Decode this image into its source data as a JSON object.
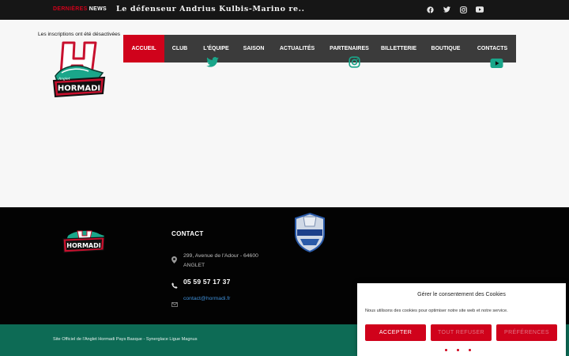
{
  "topbar": {
    "news_prefix": "DERNIÈRES",
    "news_suffix": "NEWS",
    "ticker": "Le défenseur Andrius Kulbis-Marino re..",
    "social_icons": [
      "facebook-icon",
      "twitter-icon",
      "instagram-icon",
      "youtube-icon"
    ]
  },
  "header": {
    "notice": "Les inscriptions ont été désactivées",
    "logo_text": "HORMADI",
    "logo_letter": "H",
    "logo_small": "Anglet"
  },
  "nav": {
    "items": [
      {
        "label": "ACCUEIL",
        "active": true
      },
      {
        "label": "CLUB",
        "active": false
      },
      {
        "label": "L'ÉQUIPE",
        "active": false
      },
      {
        "label": "SAISON",
        "active": false
      },
      {
        "label": "ACTUALITÉS",
        "active": false
      },
      {
        "label": "PARTENAIRES",
        "active": false
      },
      {
        "label": "BILLETTERIE",
        "active": false
      },
      {
        "label": "BOUTIQUE",
        "active": false
      },
      {
        "label": "CONTACTS",
        "active": false
      }
    ]
  },
  "footer": {
    "contact_heading": "CONTACT",
    "address_line1": "299, Avenue de l'Adour - 64600",
    "address_line2": "ANGLET",
    "phone": "05 59 57 17 37",
    "email": "contact@hormadi.fr",
    "copyright": "Site Officiel de l'Anglet Hormadi Pays Basque - Synerglace Ligue Magnus"
  },
  "cookie": {
    "title": "Gérer le consentement des Cookies",
    "text": "Nous utilisons des cookies pour optimiser notre site web et notre service.",
    "accept": "ACCEPTER",
    "deny": "TOUT REFUSER",
    "prefs": "PRÉFÉRENCES"
  },
  "colors": {
    "accent": "#d0021b",
    "topbar": "#161616",
    "nav": "#3b3b3b",
    "footer": "#030303",
    "bottombar": "#0d6b55",
    "teal": "#1aa68a"
  }
}
